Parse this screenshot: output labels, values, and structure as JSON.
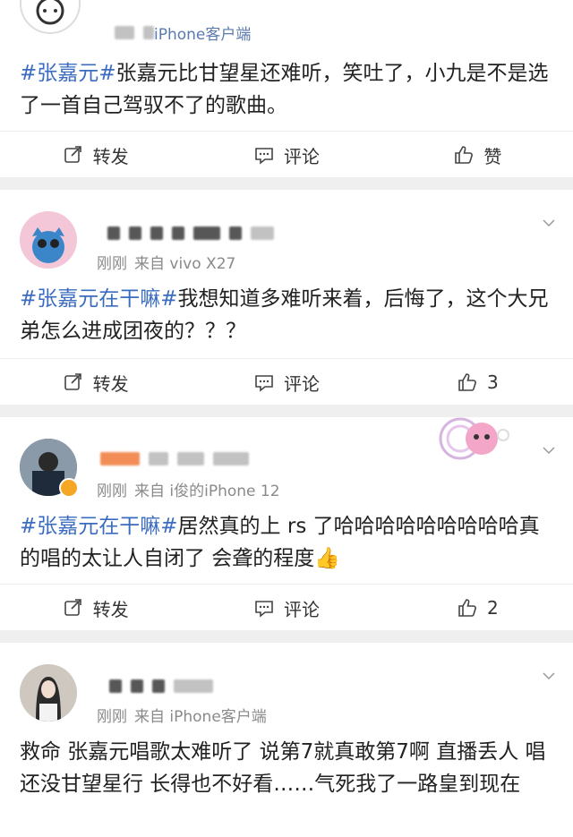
{
  "posts": [
    {
      "source": "iPhone客户端",
      "tag1": "#张嘉元#",
      "text": "张嘉元比甘望星还难听，笑吐了，小九是不是选了一首自己驾驭不了的歌曲。",
      "actions": {
        "repost": "转发",
        "comment": "评论",
        "like": "赞"
      }
    },
    {
      "time": "刚刚",
      "source": "来自 vivo X27",
      "tag1": "#张嘉元在干嘛#",
      "text": "我想知道多难听来着，后悔了，这个大兄弟怎么进成团夜的？？？",
      "actions": {
        "repost": "转发",
        "comment": "评论",
        "like": "3"
      }
    },
    {
      "time": "刚刚",
      "source": "来自 i俊的iPhone 12",
      "tag1": "#张嘉元在干嘛#",
      "text": "居然真的上 rs 了哈哈哈哈哈哈哈哈哈真的唱的太让人自闭了 会聋的程度👍",
      "actions": {
        "repost": "转发",
        "comment": "评论",
        "like": "2"
      }
    },
    {
      "time": "刚刚",
      "source": "来自 iPhone客户端",
      "text": "救命 张嘉元唱歌太难听了 说第7就真敢第7啊 直播丢人 唱还没甘望星行 长得也不好看……气死我了一路皇到现在"
    }
  ]
}
